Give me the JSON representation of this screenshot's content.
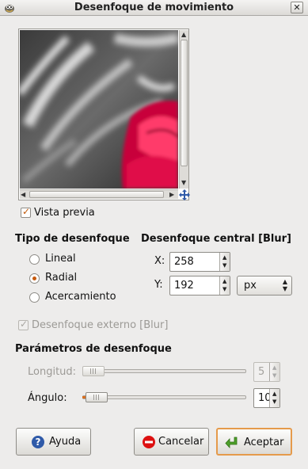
{
  "window": {
    "title": "Desenfoque de movimiento",
    "close_symbol": "✕"
  },
  "preview": {
    "vista_previa_label": "Vista previa",
    "vista_previa_checked": true
  },
  "blur_type": {
    "heading": "Tipo de desenfoque",
    "options": [
      {
        "label": "Lineal",
        "selected": false
      },
      {
        "label": "Radial",
        "selected": true
      },
      {
        "label": "Acercamiento",
        "selected": false
      }
    ]
  },
  "center": {
    "heading": "Desenfoque central [Blur]",
    "x_label": "X:",
    "x_value": "258",
    "y_label": "Y:",
    "y_value": "192",
    "unit": "px"
  },
  "outer_blur": {
    "label": "Desenfoque externo [Blur]",
    "checked": true,
    "enabled": false
  },
  "params": {
    "heading": "Parámetros de desenfoque",
    "length_label": "Longitud:",
    "length_value": "5",
    "length_enabled": false,
    "angle_label": "Ángulo:",
    "angle_value": "10"
  },
  "buttons": {
    "help": "Ayuda",
    "cancel": "Cancelar",
    "ok": "Aceptar"
  },
  "icons": {
    "app": "gimp-wilber-icon",
    "navigate": "navigate-move-icon",
    "help": "help-question-icon",
    "cancel": "cancel-no-entry-icon",
    "ok": "ok-green-arrow-icon"
  },
  "colors": {
    "accent": "#d96f1f",
    "rose": "#e0104a"
  }
}
